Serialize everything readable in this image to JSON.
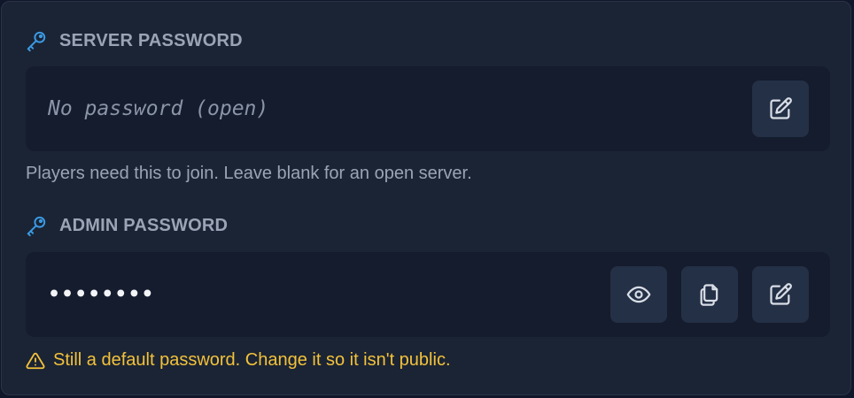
{
  "server_password": {
    "title": "SERVER PASSWORD",
    "title_icon": "key-icon",
    "value": "No password (open)",
    "actions": [
      {
        "name": "edit",
        "icon": "edit-icon"
      }
    ],
    "hint": "Players need this to join. Leave blank for an open server."
  },
  "admin_password": {
    "title": "ADMIN PASSWORD",
    "title_icon": "key-icon",
    "masked_value": "••••••••",
    "actions": [
      {
        "name": "show",
        "icon": "eye-icon"
      },
      {
        "name": "copy",
        "icon": "copy-icon"
      },
      {
        "name": "edit",
        "icon": "edit-icon"
      }
    ],
    "warning": "Still a default password. Change it so it isn't public.",
    "warning_icon": "warning-icon"
  },
  "colors": {
    "panel_bg": "#1b2434",
    "field_bg": "#141c2d",
    "button_bg": "#243046",
    "heading_text": "#9aa4b6",
    "key_icon": "#3b9be6",
    "warning": "#f3c23b"
  }
}
